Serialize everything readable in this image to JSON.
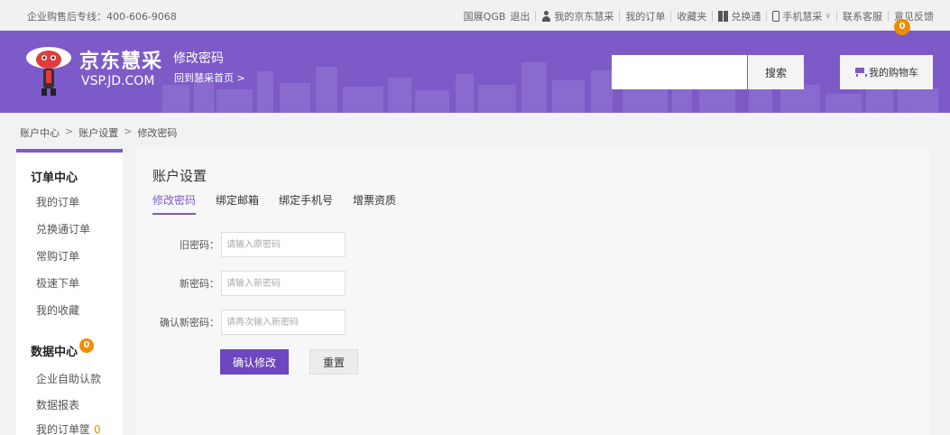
{
  "topbar": {
    "hotline": "企业购售后专线：400-606-9068",
    "user": "国展QGB",
    "logout": "退出",
    "my_vsp": "我的京东慧采",
    "my_orders": "我的订单",
    "favorites": "收藏夹",
    "exchange": "兑换通",
    "mobile": "手机慧采",
    "support": "联系客服",
    "feedback": "意见反馈"
  },
  "header": {
    "brand": "京东慧采",
    "brand_domain": "VSP.JD.COM",
    "page_name": "修改密码",
    "home_link": "回到慧采首页 >",
    "search_placeholder": "",
    "search_button": "搜索",
    "cart_label": "我的购物车",
    "cart_count": "0",
    "accent_color": "#7c5bc8"
  },
  "breadcrumb": [
    "账户中心",
    "账户设置",
    "修改密码"
  ],
  "breadcrumb_sep": ">",
  "sidebar": {
    "order_center": {
      "title": "订单中心",
      "items": [
        "我的订单",
        "兑换通订单",
        "常购订单",
        "极速下单",
        "我的收藏"
      ]
    },
    "data_center": {
      "title": "数据中心",
      "badge": "0",
      "items": [
        "企业自助认款",
        "数据报表",
        "我的订单筐"
      ],
      "basket_count": "0"
    }
  },
  "main": {
    "title": "账户设置",
    "tabs": [
      "修改密码",
      "绑定邮箱",
      "绑定手机号",
      "增票资质"
    ],
    "active_tab": "修改密码",
    "form": {
      "old_label": "旧密码：",
      "old_placeholder": "请输入原密码",
      "new_label": "新密码：",
      "new_placeholder": "请输入新密码",
      "confirm_label": "确认新密码：",
      "confirm_placeholder": "请再次输入新密码"
    },
    "confirm_button": "确认修改",
    "reset_button": "重置"
  }
}
